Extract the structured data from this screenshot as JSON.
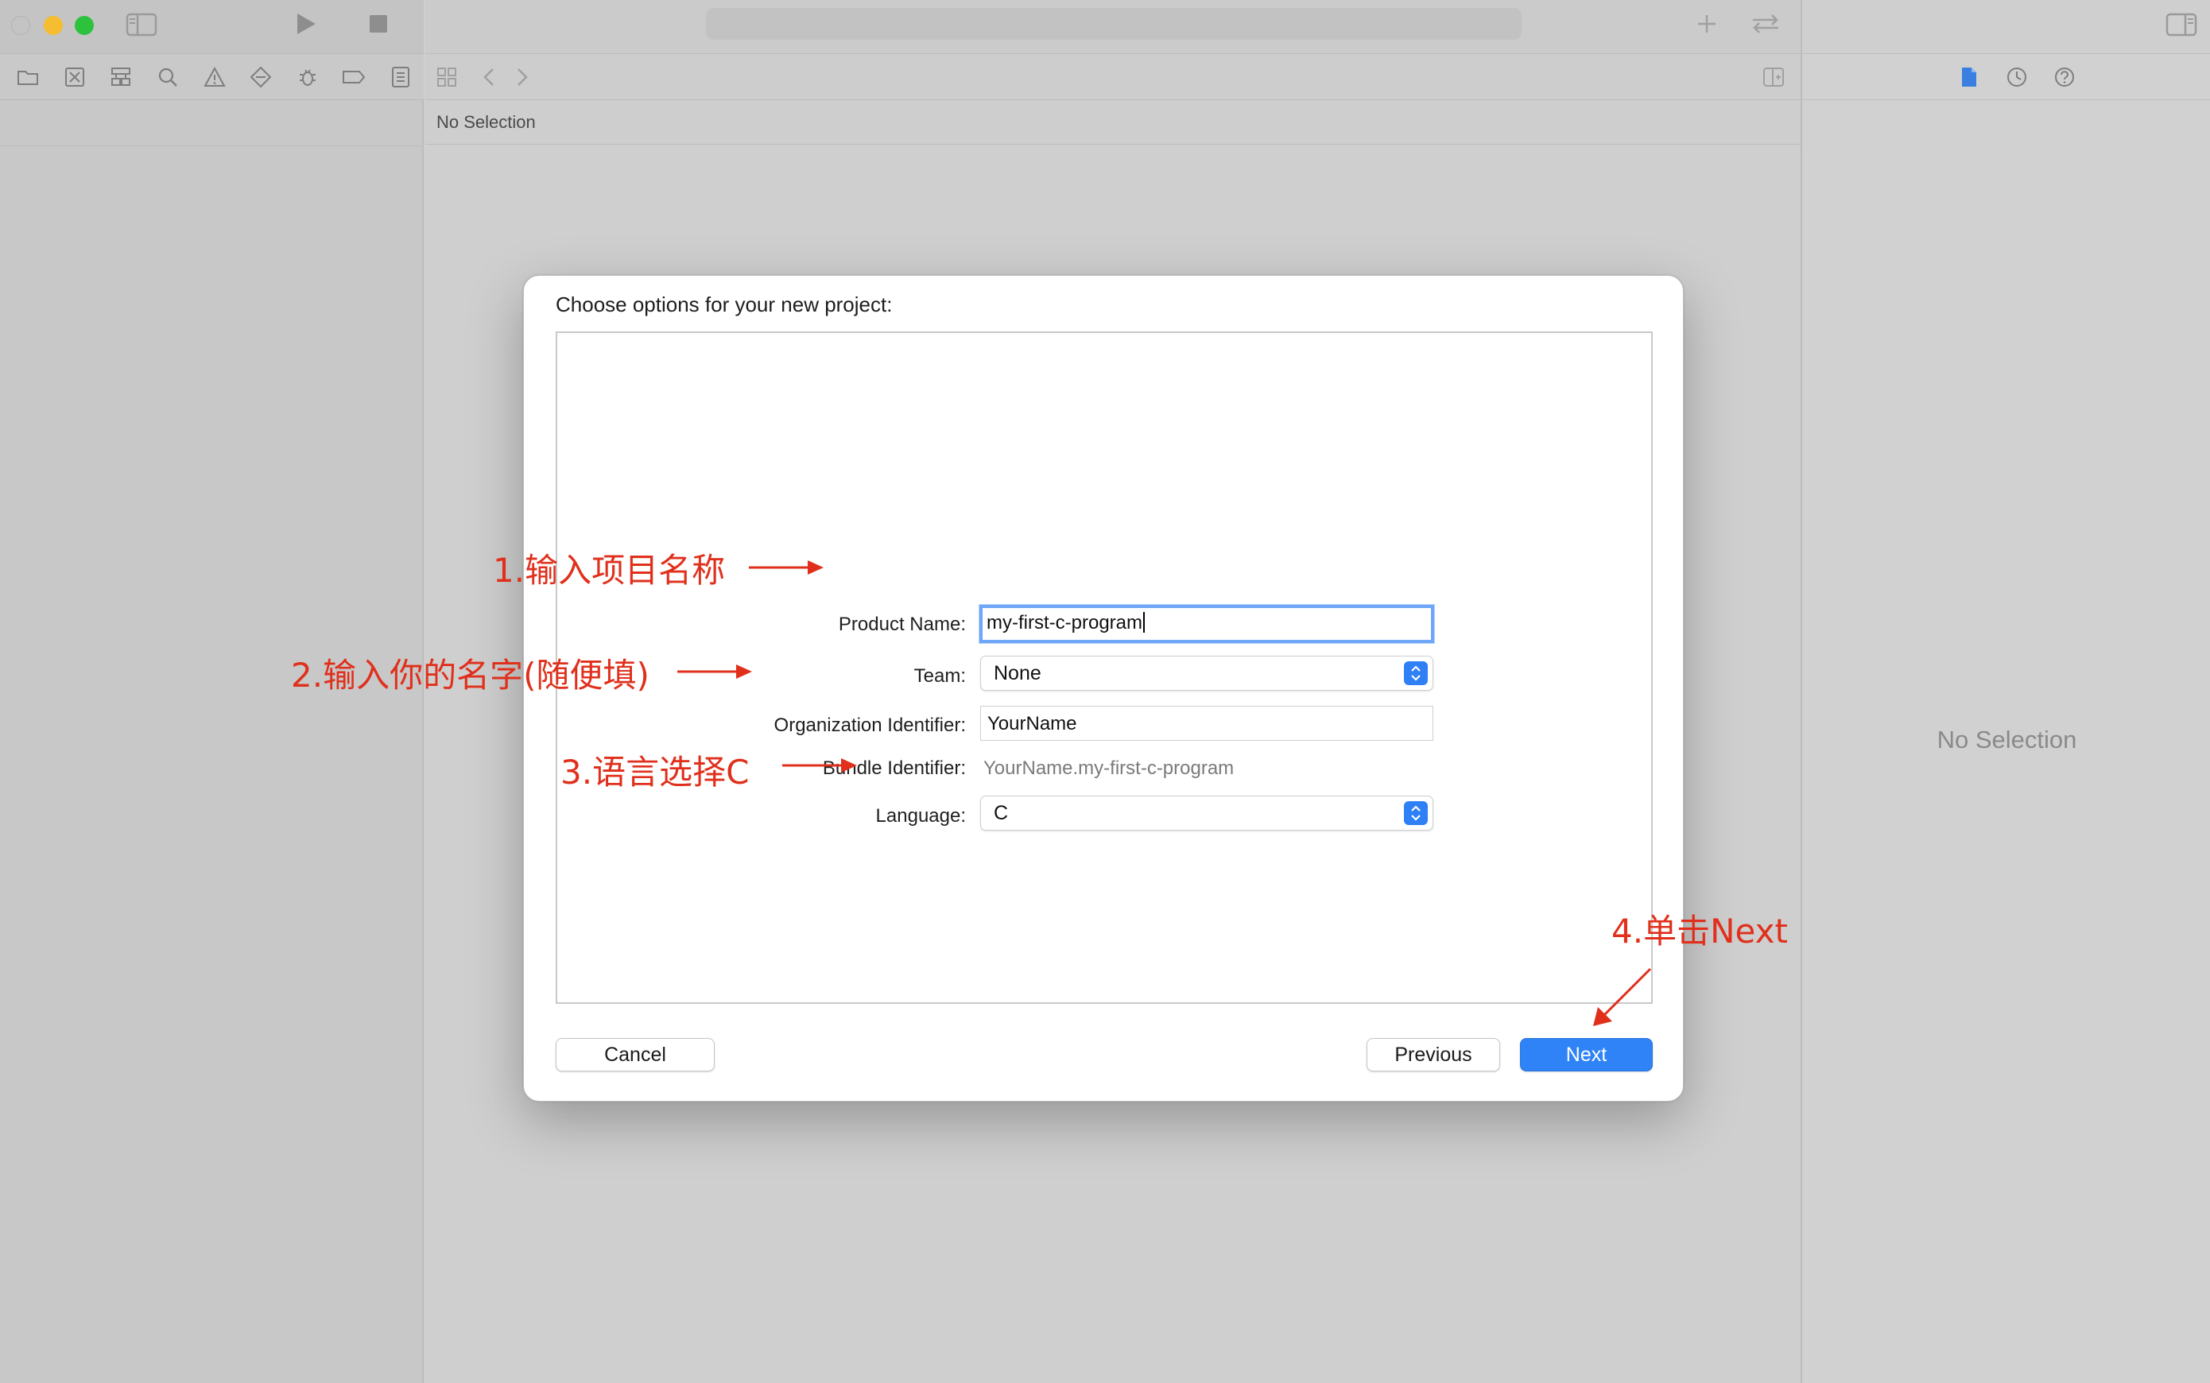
{
  "window": {
    "path_bar_text": "No Selection",
    "inspector_placeholder": "No Selection"
  },
  "dialog": {
    "title": "Choose options for your new project:",
    "fields": {
      "product_name_label": "Product Name:",
      "product_name_value": "my-first-c-program",
      "team_label": "Team:",
      "team_value": "None",
      "org_id_label": "Organization Identifier:",
      "org_id_value": "YourName",
      "bundle_id_label": "Bundle Identifier:",
      "bundle_id_value": "YourName.my-first-c-program",
      "language_label": "Language:",
      "language_value": "C"
    },
    "buttons": {
      "cancel": "Cancel",
      "previous": "Previous",
      "next": "Next"
    }
  },
  "annotations": {
    "step1": "1.输入项目名称",
    "step2": "2.输入你的名字(随便填)",
    "step3": "3.语言选择C",
    "step4": "4.单击Next",
    "color": "#e0301c"
  },
  "colors": {
    "accent": "#2f83f6",
    "focus_ring": "#6fa6f7",
    "traffic_close": "#c4c4c4",
    "traffic_minimize": "#f5bd2f",
    "traffic_zoom": "#2dc23d"
  },
  "icons": {
    "navigator": [
      "folder-icon",
      "source-control-icon",
      "symbol-icon",
      "find-icon",
      "issue-icon",
      "test-icon",
      "debug-icon",
      "breakpoint-icon",
      "report-icon"
    ],
    "inspector": [
      "file-inspector-icon",
      "history-icon",
      "help-icon"
    ]
  }
}
